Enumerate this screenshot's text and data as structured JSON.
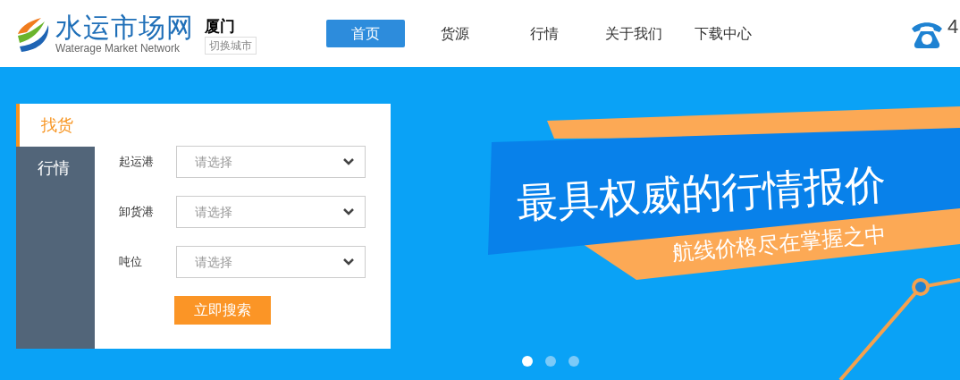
{
  "logo": {
    "title": "水运市场网",
    "subtitle": "Waterage Market Network"
  },
  "city": {
    "name": "厦门",
    "switch_label": "切换城市"
  },
  "nav": [
    {
      "label": "首页",
      "selected": true
    },
    {
      "label": "货源",
      "selected": false
    },
    {
      "label": "行情",
      "selected": false
    },
    {
      "label": "关于我们",
      "selected": false
    },
    {
      "label": "下载中心",
      "selected": false
    }
  ],
  "phone": {
    "number": "4"
  },
  "search_panel": {
    "tabs": [
      {
        "label": "找货",
        "selected": true
      },
      {
        "label": "行情",
        "selected": false
      }
    ],
    "fields": [
      {
        "label": "起运港",
        "placeholder": "请选择"
      },
      {
        "label": "卸货港",
        "placeholder": "请选择"
      },
      {
        "label": "吨位",
        "placeholder": "请选择"
      }
    ],
    "button": "立即搜索"
  },
  "banner": {
    "headline": "最具权威的行情报价",
    "subline": "航线价格尽在掌握之中",
    "dots": [
      {
        "selected": true
      },
      {
        "selected": false
      },
      {
        "selected": false
      }
    ]
  }
}
